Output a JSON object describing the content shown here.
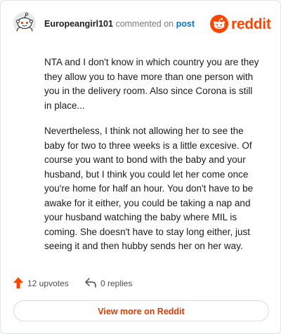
{
  "comment": {
    "username": "Europeangirl101",
    "action_text": "commented on",
    "post_link": "post",
    "paragraphs": [
      "NTA and I don't know in which country you are they they allow you to have more than one person with you in the delivery room. Also since Corona is still in place...",
      "Nevertheless, I think not allowing her to see the baby for two to three weeks is a little excesive. Of course you want to bond with the baby and your husband, but I think you could let her come once you're home for half an hour. You don't have to be awake for it either, you could be taking a nap and your husband watching the baby where MIL is coming. She doesn't have to stay long either, just seeing it and then hubby sends her on her way."
    ]
  },
  "brand": {
    "name": "reddit",
    "color": "#ff4500"
  },
  "actions": {
    "upvotes": "12 upvotes",
    "replies": "0 replies"
  },
  "footer": {
    "view_more": "View more on Reddit"
  },
  "icons": {
    "avatar": "snoo-avatar-icon",
    "logo": "reddit-snoo-icon",
    "upvote": "upvote-arrow-icon",
    "reply": "reply-arrow-icon"
  }
}
